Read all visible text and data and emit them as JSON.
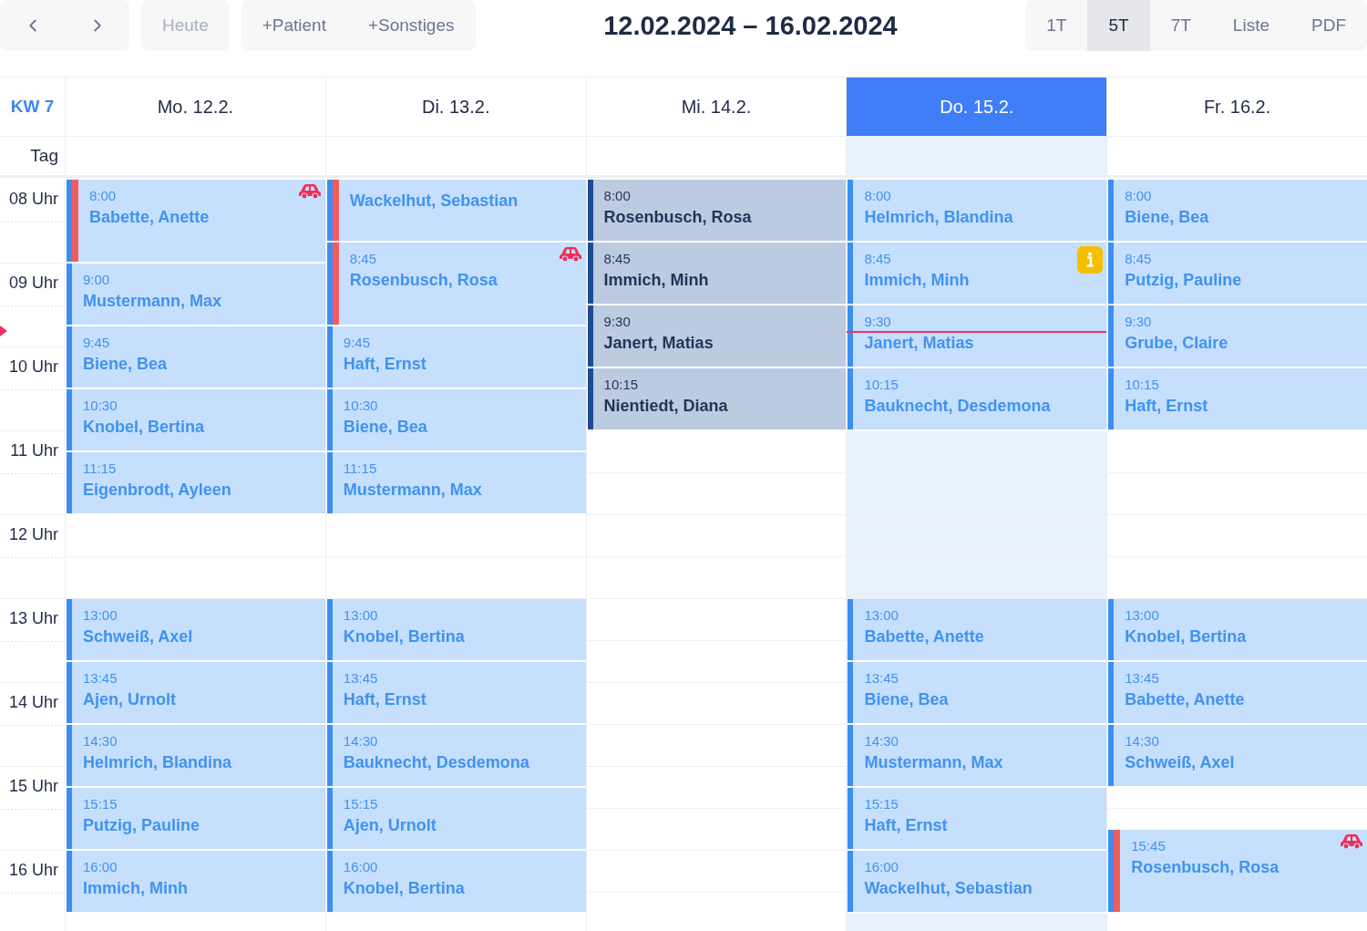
{
  "toolbar": {
    "today": "Heute",
    "add_patient": "+Patient",
    "add_other": "+Sonstiges",
    "title": "12.02.2024 – 16.02.2024",
    "views": [
      {
        "label": "1T",
        "selected": false
      },
      {
        "label": "5T",
        "selected": true
      },
      {
        "label": "7T",
        "selected": false
      },
      {
        "label": "Liste",
        "selected": false
      },
      {
        "label": "PDF",
        "selected": false
      }
    ]
  },
  "week_label": "KW 7",
  "allday_label": "Tag",
  "now_marker": {
    "level": 0.2
  },
  "hours": [
    "08 Uhr",
    "09 Uhr",
    "10 Uhr",
    "11 Uhr",
    "12 Uhr",
    "13 Uhr",
    "14 Uhr",
    "15 Uhr",
    "16 Uhr"
  ],
  "days": [
    {
      "label": "Mo. 12.2.",
      "selected": false,
      "events": [
        {
          "time": "8:00",
          "name": "Babette, Anette",
          "flagged": true,
          "car": true,
          "info": false,
          "dimmed": false
        },
        {
          "time": "9:00",
          "name": "Mustermann, Max",
          "flagged": false,
          "car": false,
          "info": false,
          "dimmed": false
        },
        {
          "time": "9:45",
          "name": "Biene, Bea",
          "flagged": false,
          "car": false,
          "info": false,
          "dimmed": false
        },
        {
          "time": "10:30",
          "name": "Knobel, Bertina",
          "flagged": false,
          "car": false,
          "info": false,
          "dimmed": false
        },
        {
          "time": "11:15",
          "name": "Eigenbrodt, Ayleen",
          "flagged": false,
          "car": false,
          "info": false,
          "dimmed": false
        },
        {
          "time": "13:00",
          "name": "Schweiß, Axel",
          "flagged": false,
          "car": false,
          "info": false,
          "dimmed": false
        },
        {
          "time": "13:45",
          "name": "Ajen, Urnolt",
          "flagged": false,
          "car": false,
          "info": false,
          "dimmed": false
        },
        {
          "time": "14:30",
          "name": "Helmrich, Blandina",
          "flagged": false,
          "car": false,
          "info": false,
          "dimmed": false
        },
        {
          "time": "15:15",
          "name": "Putzig, Pauline",
          "flagged": false,
          "car": false,
          "info": false,
          "dimmed": false
        },
        {
          "time": "16:00",
          "name": "Immich, Minh",
          "flagged": false,
          "car": false,
          "info": false,
          "dimmed": false
        }
      ]
    },
    {
      "label": "Di. 13.2.",
      "selected": false,
      "events": [
        {
          "name": "Wackelhut, Sebastian",
          "flagged": true,
          "car": false,
          "info": false,
          "dimmed": false
        },
        {
          "time": "8:45",
          "name": "Rosenbusch, Rosa",
          "flagged": true,
          "car": true,
          "info": false,
          "dimmed": false
        },
        {
          "time": "9:45",
          "name": "Haft, Ernst",
          "flagged": false,
          "car": false,
          "info": false,
          "dimmed": false
        },
        {
          "time": "10:30",
          "name": "Biene, Bea",
          "flagged": false,
          "car": false,
          "info": false,
          "dimmed": false
        },
        {
          "time": "11:15",
          "name": "Mustermann, Max",
          "flagged": false,
          "car": false,
          "info": false,
          "dimmed": false
        },
        {
          "time": "13:00",
          "name": "Knobel, Bertina",
          "flagged": false,
          "car": false,
          "info": false,
          "dimmed": false
        },
        {
          "time": "13:45",
          "name": "Haft, Ernst",
          "flagged": false,
          "car": false,
          "info": false,
          "dimmed": false
        },
        {
          "time": "14:30",
          "name": "Bauknecht, Desdemona",
          "flagged": false,
          "car": false,
          "info": false,
          "dimmed": false
        },
        {
          "time": "15:15",
          "name": "Ajen, Urnolt",
          "flagged": false,
          "car": false,
          "info": false,
          "dimmed": false
        },
        {
          "time": "16:00",
          "name": "Knobel, Bertina",
          "flagged": false,
          "car": false,
          "info": false,
          "dimmed": false
        }
      ]
    },
    {
      "label": "Mi. 14.2.",
      "selected": false,
      "events": [
        {
          "time": "8:00",
          "name": "Rosenbusch, Rosa",
          "flagged": false,
          "car": false,
          "info": false,
          "dimmed": true
        },
        {
          "time": "8:45",
          "name": "Immich, Minh",
          "flagged": false,
          "car": false,
          "info": false,
          "dimmed": true
        },
        {
          "time": "9:30",
          "name": "Janert, Matias",
          "flagged": false,
          "car": false,
          "info": false,
          "dimmed": true
        },
        {
          "time": "10:15",
          "name": "Nientiedt, Diana",
          "flagged": false,
          "car": false,
          "info": false,
          "dimmed": true
        }
      ]
    },
    {
      "label": "Do. 15.2.",
      "selected": true,
      "events": [
        {
          "time": "8:00",
          "name": "Helmrich, Blandina",
          "flagged": false,
          "car": false,
          "info": false,
          "dimmed": false
        },
        {
          "time": "8:45",
          "name": "Immich, Minh",
          "flagged": false,
          "car": false,
          "info": true,
          "dimmed": false
        },
        {
          "time": "9:30",
          "name": "Janert, Matias",
          "flagged": false,
          "car": false,
          "info": false,
          "dimmed": false
        },
        {
          "time": "10:15",
          "name": "Bauknecht, Desdemona",
          "flagged": false,
          "car": false,
          "info": false,
          "dimmed": false
        },
        {
          "time": "13:00",
          "name": "Babette, Anette",
          "flagged": false,
          "car": false,
          "info": false,
          "dimmed": false
        },
        {
          "time": "13:45",
          "name": "Biene, Bea",
          "flagged": false,
          "car": false,
          "info": false,
          "dimmed": false
        },
        {
          "time": "14:30",
          "name": "Mustermann, Max",
          "flagged": false,
          "car": false,
          "info": false,
          "dimmed": false
        },
        {
          "time": "15:15",
          "name": "Haft, Ernst",
          "flagged": false,
          "car": false,
          "info": false,
          "dimmed": false
        },
        {
          "time": "16:00",
          "name": "Wackelhut, Sebastian",
          "flagged": false,
          "car": false,
          "info": false,
          "dimmed": false
        }
      ]
    },
    {
      "label": "Fr. 16.2.",
      "selected": false,
      "events": [
        {
          "time": "8:00",
          "name": "Biene, Bea",
          "flagged": false,
          "car": false,
          "info": false,
          "dimmed": false
        },
        {
          "time": "8:45",
          "name": "Putzig, Pauline",
          "flagged": false,
          "car": false,
          "info": false,
          "dimmed": false
        },
        {
          "time": "9:30",
          "name": "Grube, Claire",
          "flagged": false,
          "car": false,
          "info": false,
          "dimmed": false
        },
        {
          "time": "10:15",
          "name": "Haft, Ernst",
          "flagged": false,
          "car": false,
          "info": false,
          "dimmed": false
        },
        {
          "time": "13:00",
          "name": "Knobel, Bertina",
          "flagged": false,
          "car": false,
          "info": false,
          "dimmed": false
        },
        {
          "time": "13:45",
          "name": "Babette, Anette",
          "flagged": false,
          "car": false,
          "info": false,
          "dimmed": false
        },
        {
          "time": "14:30",
          "name": "Schweiß, Axel",
          "flagged": false,
          "car": false,
          "info": false,
          "dimmed": false
        },
        {
          "time": "15:45",
          "name": "Rosenbusch, Rosa",
          "flagged": true,
          "car": true,
          "info": false,
          "dimmed": false
        }
      ]
    }
  ]
}
